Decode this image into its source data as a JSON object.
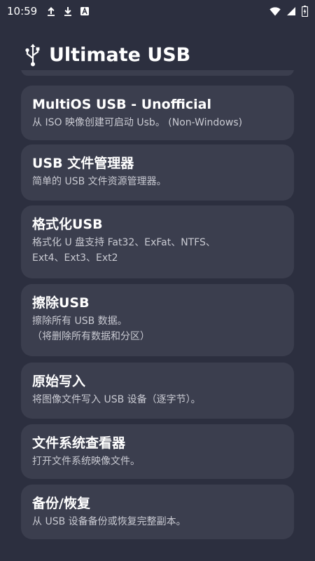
{
  "status_bar": {
    "time": "10:59",
    "left_icons": [
      "upload-icon",
      "download-icon",
      "a-notification-icon"
    ],
    "right_icons": [
      "wifi-icon",
      "signal-icon",
      "battery-charging-icon"
    ]
  },
  "header": {
    "icon": "usb-icon",
    "title": "Ultimate USB"
  },
  "colors": {
    "background": "#2c2f3f",
    "card": "#3b3e4e",
    "title_text": "#ffffff",
    "desc_text": "#c9cad2"
  },
  "cards": [
    {
      "title": "MultiOS USB - Unofficial",
      "desc": "从 ISO 映像创建可启动 Usb。 (Non-Windows)"
    },
    {
      "title": "USB 文件管理器",
      "desc": "简单的 USB 文件资源管理器。"
    },
    {
      "title": "格式化USB",
      "desc": "格式化 U 盘支持 Fat32、ExFat、NTFS、\nExt4、Ext3、Ext2"
    },
    {
      "title": "擦除USB",
      "desc": "擦除所有 USB 数据。\n（将删除所有数据和分区）"
    },
    {
      "title": "原始写入",
      "desc": "将图像文件写入 USB 设备（逐字节）。"
    },
    {
      "title": "文件系统查看器",
      "desc": "打开文件系统映像文件。"
    },
    {
      "title": "备份/恢复",
      "desc": "从 USB 设备备份或恢复完整副本。"
    }
  ]
}
